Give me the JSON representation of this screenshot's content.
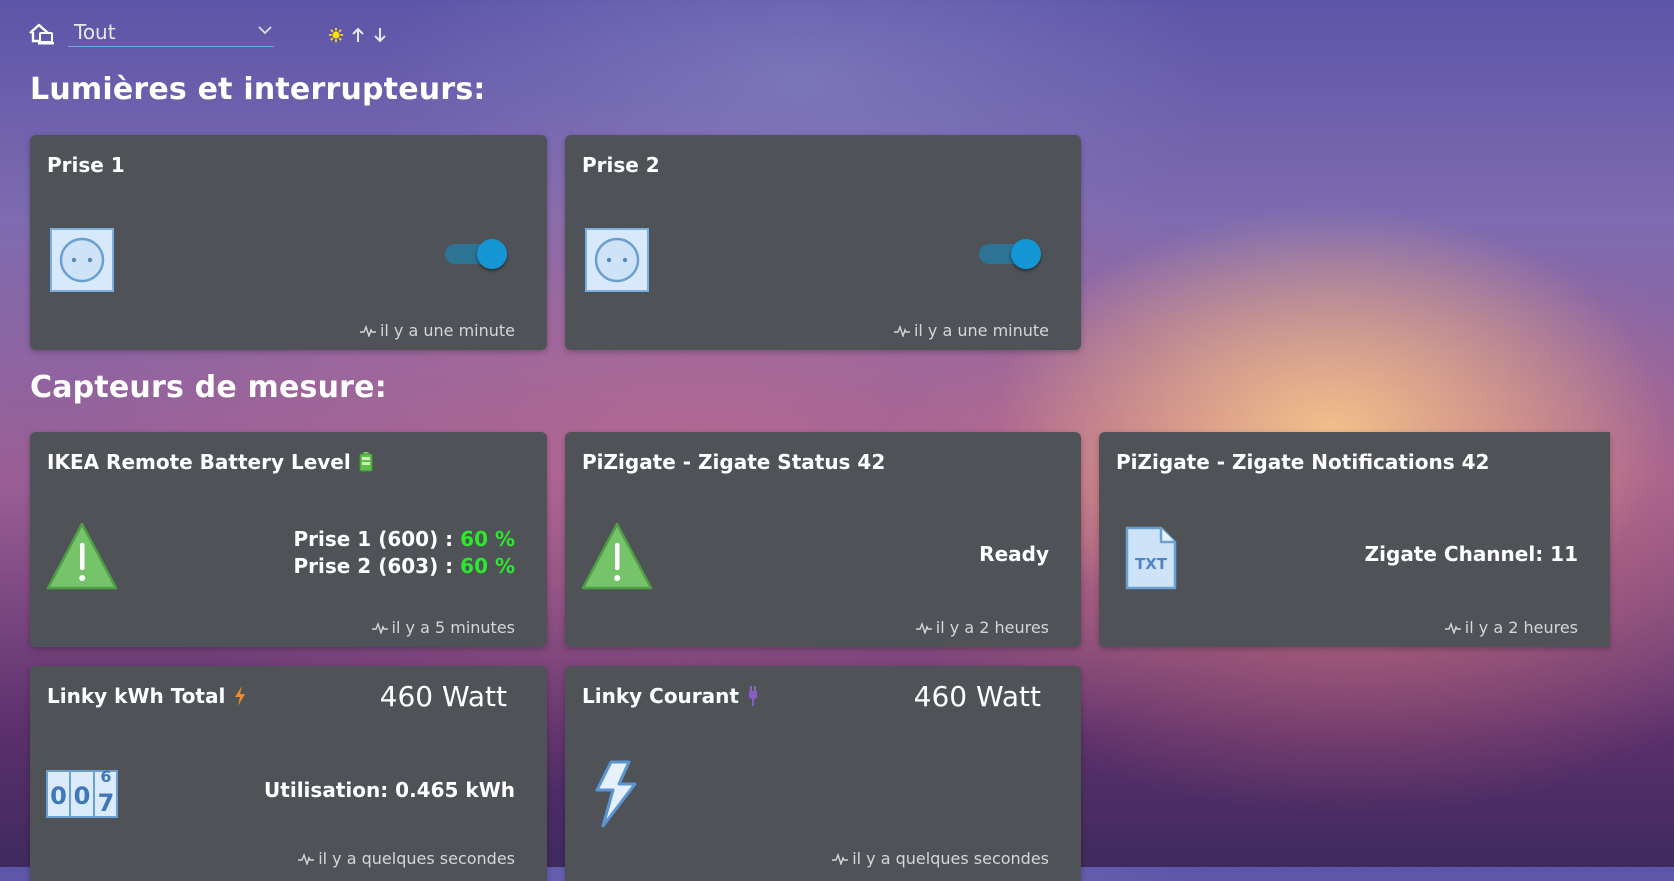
{
  "topbar": {
    "select_value": "Tout",
    "icons": [
      "home-devices-icon",
      "chevron-down-icon",
      "sun-icon",
      "arrow-up-icon",
      "arrow-down-icon"
    ]
  },
  "sections": {
    "lights": "Lumières et interrupteurs:",
    "sensors": "Capteurs de mesure:"
  },
  "cards": {
    "prise1": {
      "title": "Prise 1",
      "updated": "il y a une minute",
      "on": true,
      "icon": "power-socket-icon"
    },
    "prise2": {
      "title": "Prise 2",
      "updated": "il y a une minute",
      "on": true,
      "icon": "power-socket-icon"
    },
    "ikea": {
      "title": "IKEA Remote Battery Level",
      "line1_label": "Prise 1 (600) :",
      "line1_value": "60 %",
      "line2_label": "Prise 2 (603) :",
      "line2_value": "60 %",
      "updated": "il y a 5 minutes",
      "icon": "warning-triangle-icon"
    },
    "status": {
      "title": "PiZigate - Zigate Status 42",
      "value": "Ready",
      "updated": "il y a 2 heures",
      "icon": "warning-triangle-icon"
    },
    "notifications": {
      "title": "PiZigate - Zigate Notifications 42",
      "value": "Zigate Channel: 11",
      "updated": "il y a 2 heures",
      "icon": "txt-file-icon"
    },
    "linky_total": {
      "title": "Linky kWh Total",
      "big": "460 Watt",
      "value": "Utilisation: 0.465 kWh",
      "updated": "il y a quelques secondes",
      "icon": "counter-icon"
    },
    "linky_courant": {
      "title": "Linky Courant",
      "big": "460 Watt",
      "updated": "il y a quelques secondes",
      "icon": "lightning-icon"
    }
  },
  "colors": {
    "card_bg": "#4f5357",
    "accent": "#1597d6",
    "ok_green": "#2ee82e"
  }
}
